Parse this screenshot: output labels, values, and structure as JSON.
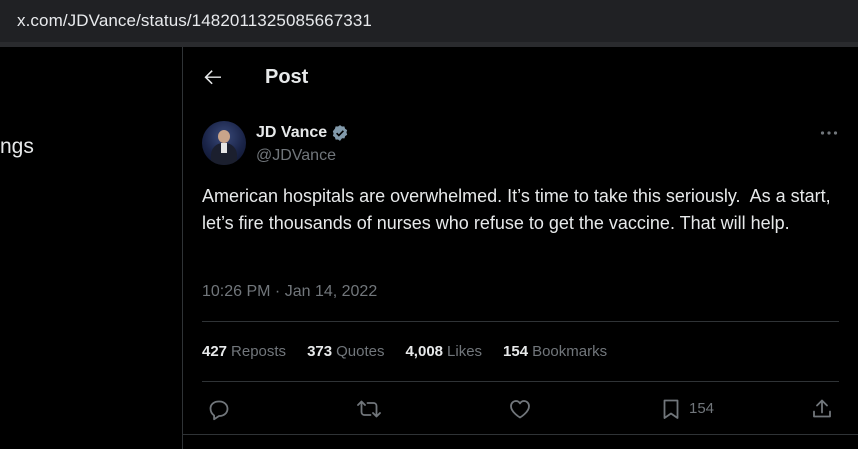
{
  "browser": {
    "url": "x.com/JDVance/status/1482011325085667331"
  },
  "left_nav": {
    "visible_label": "ngs"
  },
  "header": {
    "title": "Post",
    "back_icon": "arrow-left-icon"
  },
  "author": {
    "display_name": "JD Vance",
    "handle": "@JDVance",
    "verified": true,
    "verified_icon": "verified-badge-icon",
    "verified_color": "#829aab"
  },
  "post": {
    "text": "American hospitals are overwhelmed. It’s time to take this seriously.  As a start, let’s fire thousands of nurses who refuse to get the vaccine. That will help.",
    "timestamp": "10:26 PM · Jan 14, 2022"
  },
  "stats": {
    "reposts": {
      "count": "427",
      "label": "Reposts"
    },
    "quotes": {
      "count": "373",
      "label": "Quotes"
    },
    "likes": {
      "count": "4,008",
      "label": "Likes"
    },
    "bookmarks": {
      "count": "154",
      "label": "Bookmarks"
    }
  },
  "actions": {
    "reply_icon": "reply-icon",
    "repost_icon": "repost-icon",
    "like_icon": "heart-icon",
    "bookmark_icon": "bookmark-icon",
    "bookmark_count": "154",
    "share_icon": "share-icon"
  },
  "colors": {
    "background": "#000000",
    "text_primary": "#e7e9ea",
    "text_secondary": "#71767b",
    "divider": "#2f3336",
    "urlbar": "#202124"
  }
}
